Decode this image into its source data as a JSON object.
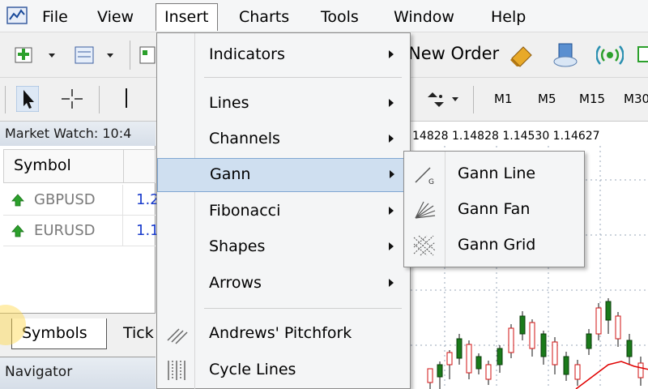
{
  "menubar": {
    "items": [
      {
        "label": "File"
      },
      {
        "label": "View"
      },
      {
        "label": "Insert"
      },
      {
        "label": "Charts"
      },
      {
        "label": "Tools"
      },
      {
        "label": "Window"
      },
      {
        "label": "Help"
      }
    ],
    "active_index": 2
  },
  "toolbar": {
    "new_order_label": "New Order",
    "timeframes": [
      "M1",
      "M5",
      "M15",
      "M30"
    ]
  },
  "market_watch": {
    "title": "Market Watch: 10:4",
    "column_symbol": "Symbol",
    "rows": [
      {
        "symbol": "GBPUSD",
        "price": "1.2",
        "direction": "up"
      },
      {
        "symbol": "EURUSD",
        "price": "1.1",
        "direction": "up"
      }
    ],
    "tabs": [
      {
        "label": "Symbols",
        "active": true
      },
      {
        "label": "Tick",
        "active": false
      }
    ]
  },
  "navigator": {
    "title": "Navigator"
  },
  "chart": {
    "price_header": "14828 1.14828 1.14530 1.14627",
    "colors": {
      "bull": "#1a7a1a",
      "bear": "#d01010",
      "ma": "#e00000",
      "grid": "#9aa7b8"
    }
  },
  "insert_menu": {
    "items": [
      {
        "label": "Indicators",
        "submenu": true
      },
      {
        "label": "Lines",
        "submenu": true
      },
      {
        "label": "Channels",
        "submenu": true
      },
      {
        "label": "Gann",
        "submenu": true,
        "highlighted": true
      },
      {
        "label": "Fibonacci",
        "submenu": true
      },
      {
        "label": "Shapes",
        "submenu": true
      },
      {
        "label": "Arrows",
        "submenu": true
      },
      {
        "label": "Andrews' Pitchfork",
        "icon": "pitchfork-icon"
      },
      {
        "label": "Cycle Lines",
        "icon": "cycle-lines-icon"
      }
    ]
  },
  "gann_menu": {
    "items": [
      {
        "label": "Gann Line",
        "icon": "gann-line-icon"
      },
      {
        "label": "Gann Fan",
        "icon": "gann-fan-icon"
      },
      {
        "label": "Gann Grid",
        "icon": "gann-grid-icon"
      }
    ]
  },
  "accent_colors": {
    "menu_highlight": "#cfdff0",
    "menu_highlight_border": "#7fa6d2",
    "price_text": "#1a3ccc"
  }
}
